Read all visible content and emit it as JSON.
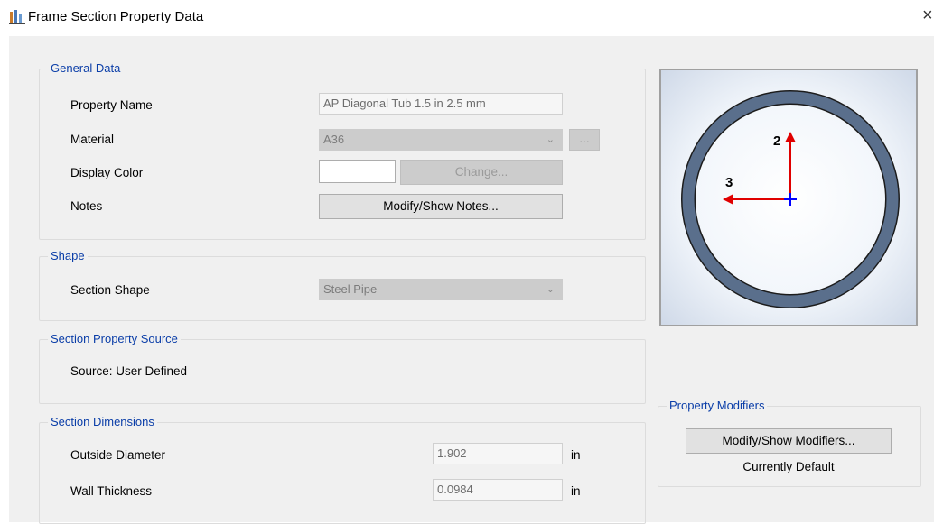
{
  "window": {
    "title": "Frame Section Property Data",
    "close_label": "×"
  },
  "general": {
    "legend": "General Data",
    "property_name_label": "Property Name",
    "property_name_value": "AP Diagonal Tub 1.5 in 2.5 mm",
    "material_label": "Material",
    "material_value": "A36",
    "material_more_label": "...",
    "display_color_label": "Display Color",
    "change_label": "Change...",
    "notes_label": "Notes",
    "notes_button_label": "Modify/Show Notes..."
  },
  "shape": {
    "legend": "Shape",
    "section_shape_label": "Section Shape",
    "section_shape_value": "Steel Pipe"
  },
  "source": {
    "legend": "Section Property Source",
    "text": "Source:  User Defined"
  },
  "dimensions": {
    "legend": "Section Dimensions",
    "rows": [
      {
        "label": "Outside Diameter",
        "value": "1.902",
        "unit": "in"
      },
      {
        "label": "Wall Thickness",
        "value": "0.0984",
        "unit": "in"
      }
    ]
  },
  "preview": {
    "axis_2_label": "2",
    "axis_3_label": "3",
    "colors": {
      "pipe_fill": "#5a6f8c",
      "axis_red": "#e00000",
      "axis_blue": "#0000ff"
    }
  },
  "modifiers": {
    "legend": "Property Modifiers",
    "button_label": "Modify/Show Modifiers...",
    "status": "Currently Default"
  },
  "icons": {
    "app": "etabs-app-icon",
    "dropdown": "chevron-down-icon",
    "close": "close-icon"
  }
}
